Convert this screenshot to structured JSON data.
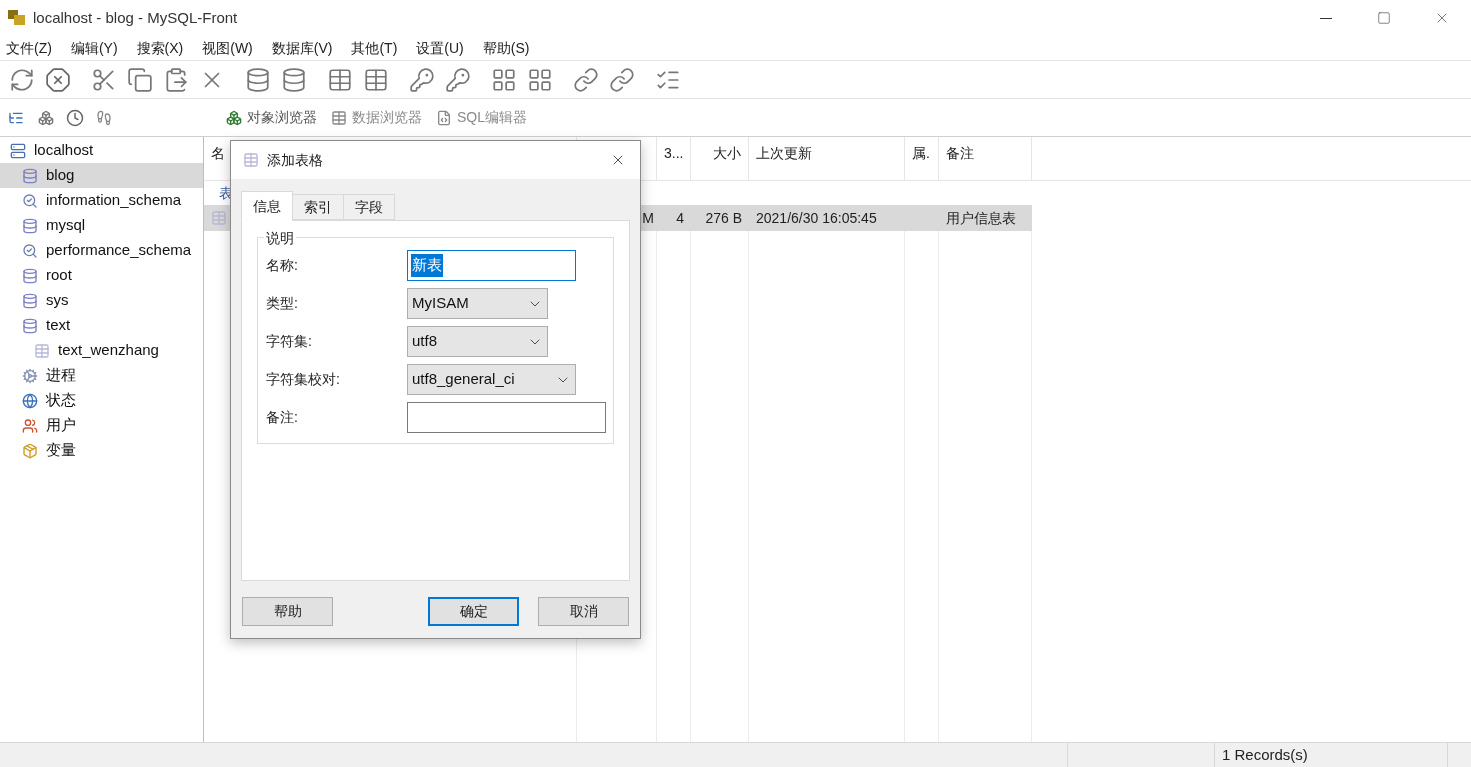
{
  "window": {
    "title": "localhost - blog - MySQL-Front"
  },
  "menu": [
    "文件(Z)",
    "编辑(Y)",
    "搜索(X)",
    "视图(W)",
    "数据库(V)",
    "其他(T)",
    "设置(U)",
    "帮助(S)"
  ],
  "views": [
    {
      "kind": "object",
      "label": "对象浏览器",
      "disabled": false
    },
    {
      "kind": "data",
      "label": "数据浏览器",
      "disabled": true
    },
    {
      "kind": "sql",
      "label": "SQL编辑器",
      "disabled": true
    }
  ],
  "tree": [
    {
      "kind": "server",
      "label": "localhost",
      "selected": false,
      "children": [
        {
          "kind": "database",
          "label": "blog",
          "selected": true
        },
        {
          "kind": "system",
          "label": "information_schema",
          "selected": false
        },
        {
          "kind": "database",
          "label": "mysql",
          "selected": false
        },
        {
          "kind": "system",
          "label": "performance_schema",
          "selected": false
        },
        {
          "kind": "database",
          "label": "root",
          "selected": false
        },
        {
          "kind": "database",
          "label": "sys",
          "selected": false
        },
        {
          "kind": "database",
          "label": "text",
          "selected": false,
          "children": [
            {
              "kind": "table",
              "label": "text_wenzhang",
              "selected": false
            }
          ]
        },
        {
          "kind": "processes",
          "label": "进程",
          "selected": false
        },
        {
          "kind": "status",
          "label": "状态",
          "selected": false
        },
        {
          "kind": "users",
          "label": "用户",
          "selected": false
        },
        {
          "kind": "variables",
          "label": "变量",
          "selected": false
        }
      ]
    }
  ],
  "table": {
    "columns": [
      "名",
      "",
      "3...",
      "大小",
      "上次更新",
      "属.",
      "备注"
    ],
    "group_row": "表",
    "rows": [
      {
        "selected": true,
        "cells": [
          "",
          "M",
          "4",
          "276 B",
          "2021/6/30 16:05:45",
          "",
          "用户信息表"
        ]
      }
    ]
  },
  "dialog": {
    "title": "添加表格",
    "tabs": [
      {
        "label": "信息",
        "selected": true
      },
      {
        "label": "索引",
        "selected": false
      },
      {
        "label": "字段",
        "selected": false
      }
    ],
    "group": "说明",
    "fields": [
      {
        "kind": "text",
        "label": "名称:",
        "value": "新表",
        "text_selected": true,
        "focused": true
      },
      {
        "kind": "select",
        "label": "类型:",
        "value": "MyISAM"
      },
      {
        "kind": "select",
        "label": "字符集:",
        "value": "utf8"
      },
      {
        "kind": "select-wide",
        "label": "字符集校对:",
        "value": "utf8_general_ci"
      },
      {
        "kind": "text",
        "label": "备注:",
        "focused": false
      }
    ],
    "buttons": [
      {
        "label": "帮助",
        "default": false
      },
      {
        "label": "确定",
        "default": true
      },
      {
        "label": "取消",
        "default": false
      }
    ]
  },
  "status_bar": {
    "records": "1 Records(s)"
  }
}
